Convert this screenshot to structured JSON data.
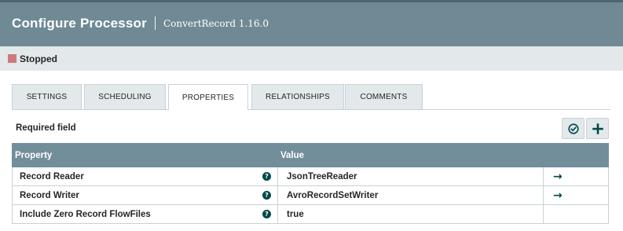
{
  "dialog": {
    "title": "Configure Processor",
    "subtitle": "ConvertRecord 1.16.0"
  },
  "status": {
    "label": "Stopped",
    "color": "#ce7a7c"
  },
  "tabs": [
    {
      "label": "SETTINGS",
      "active": false
    },
    {
      "label": "SCHEDULING",
      "active": false
    },
    {
      "label": "PROPERTIES",
      "active": true
    },
    {
      "label": "RELATIONSHIPS",
      "active": false
    },
    {
      "label": "COMMENTS",
      "active": false
    }
  ],
  "properties": {
    "required_label": "Required field",
    "verify_icon": "check-circle-icon",
    "add_icon": "plus-icon",
    "columns": {
      "property": "Property",
      "value": "Value"
    },
    "rows": [
      {
        "name": "Record Reader",
        "value": "JsonTreeReader",
        "help_icon": "?",
        "action_icon": "→"
      },
      {
        "name": "Record Writer",
        "value": "AvroRecordSetWriter",
        "help_icon": "?",
        "action_icon": "→"
      },
      {
        "name": "Include Zero Record FlowFiles",
        "value": "true",
        "help_icon": "?",
        "action_icon": ""
      }
    ]
  },
  "colors": {
    "header_bg": "#6f8a94",
    "grid_header_bg": "#728e9b",
    "accent": "#004849"
  }
}
